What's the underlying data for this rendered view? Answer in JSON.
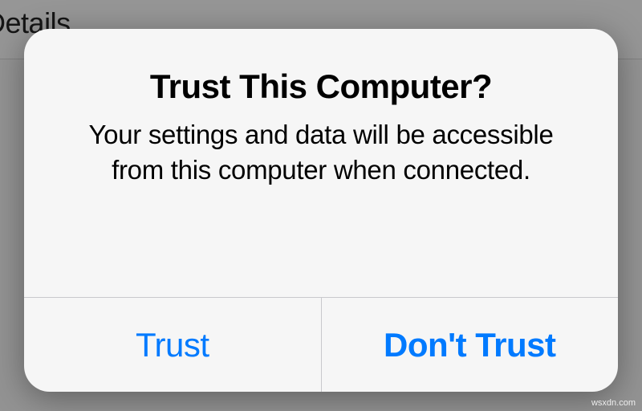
{
  "background": {
    "header_text": "e Details"
  },
  "alert": {
    "title": "Trust This Computer?",
    "message": "Your settings and data will be accessible from this computer when connected.",
    "buttons": {
      "trust": "Trust",
      "dont_trust": "Don't Trust"
    }
  },
  "watermark": "wsxdn.com"
}
